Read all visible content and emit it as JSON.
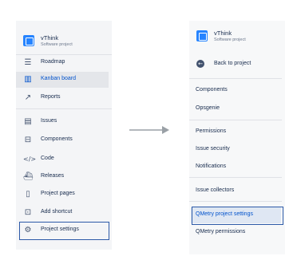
{
  "project": {
    "name": "vThink",
    "type": "Software project"
  },
  "left_nav": {
    "items": [
      {
        "label": "Roadmap",
        "icon": "roadmap-icon"
      },
      {
        "label": "Kanban board",
        "icon": "board-icon"
      },
      {
        "label": "Reports",
        "icon": "reports-icon"
      },
      {
        "label": "Issues",
        "icon": "issues-icon"
      },
      {
        "label": "Components",
        "icon": "components-icon"
      },
      {
        "label": "Code",
        "icon": "code-icon"
      },
      {
        "label": "Releases",
        "icon": "releases-icon"
      },
      {
        "label": "Project pages",
        "icon": "pages-icon"
      },
      {
        "label": "Add shortcut",
        "icon": "add-shortcut-icon"
      },
      {
        "label": "Project settings",
        "icon": "gear-icon"
      }
    ],
    "active": "Kanban board",
    "highlighted": "Project settings"
  },
  "right_nav": {
    "back_label": "Back to project",
    "items": [
      "Components",
      "Opsgenie",
      "Permissions",
      "Issue security",
      "Notifications",
      "Issue collectors",
      "QMetry project settings",
      "QMetry permissions"
    ],
    "highlighted": "QMetry project settings"
  },
  "colors": {
    "accent": "#0052cc",
    "highlight_border": "#2d5aa8",
    "sidebar_bg": "#f4f5f7",
    "arrow": "#9aa0a6"
  }
}
